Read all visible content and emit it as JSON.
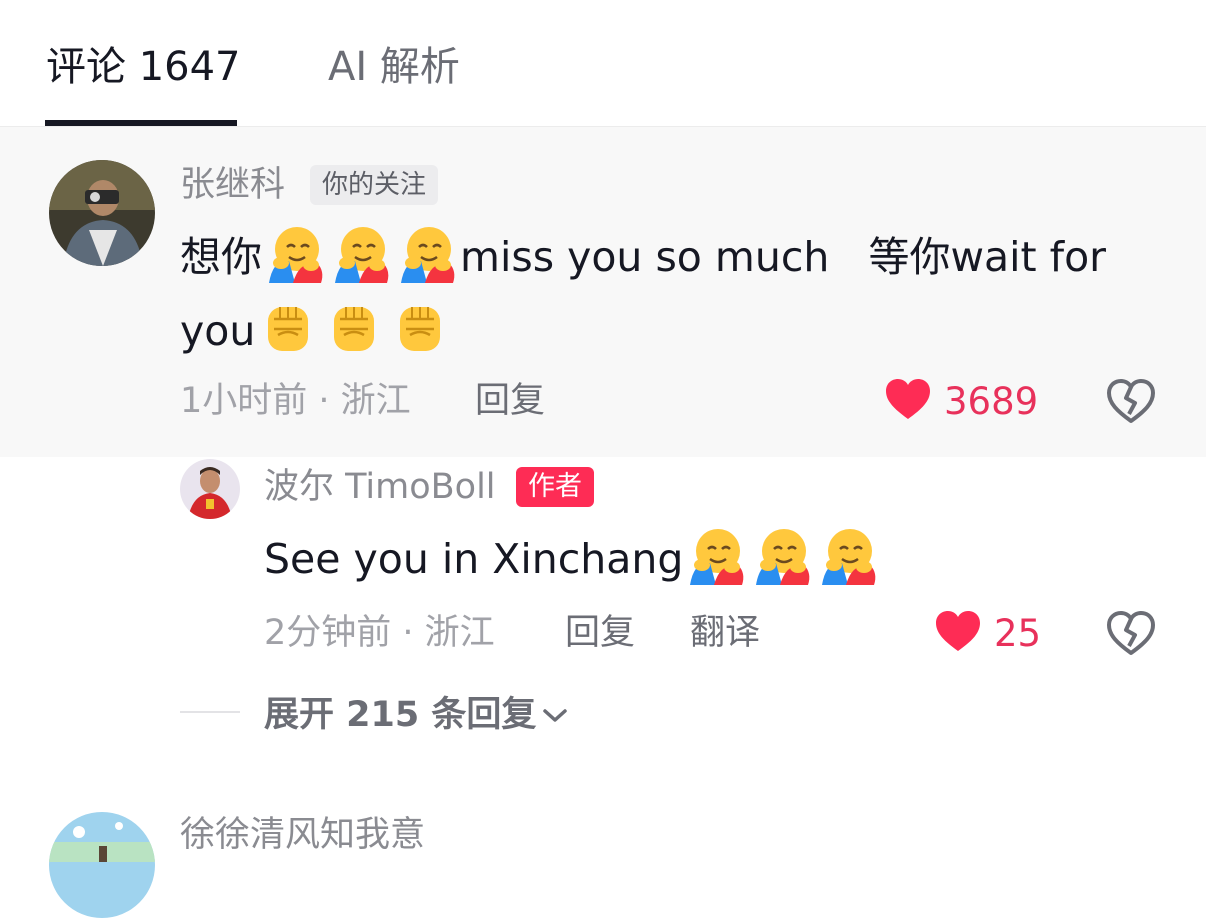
{
  "tabs": [
    {
      "label": "评论 1647",
      "active": true
    },
    {
      "label": "AI 解析",
      "active": false
    }
  ],
  "comments": [
    {
      "username": "张继科",
      "badge": "你的关注",
      "text_line1": "想你",
      "text_mid": "miss you so much   等你wait for",
      "text_line2": "you",
      "time_location": "1小时前 · 浙江",
      "reply_label": "回复",
      "likes": "3689",
      "emojis": [
        "hugging-face-emoji",
        "hugging-face-emoji",
        "hugging-face-emoji",
        "raised-fist-emoji",
        "raised-fist-emoji",
        "raised-fist-emoji"
      ]
    }
  ],
  "reply": {
    "username": "波尔 TimoBoll",
    "badge": "作者",
    "text": "See you in Xinchang",
    "time_location": "2分钟前 · 浙江",
    "reply_label": "回复",
    "translate_label": "翻译",
    "likes": "25",
    "emojis": [
      "hugging-face-emoji",
      "hugging-face-emoji",
      "hugging-face-emoji"
    ]
  },
  "expand_replies": "展开 215 条回复",
  "next_comment": {
    "username": "徐徐清风知我意"
  },
  "colors": {
    "like_red": "#fe2c55",
    "author_badge": "#fe2c55",
    "highlight_bg": "#f8f8f8"
  }
}
